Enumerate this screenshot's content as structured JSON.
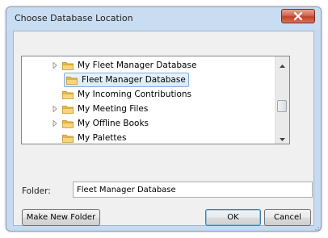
{
  "dialog": {
    "title": "Choose Database Location"
  },
  "tree": {
    "items": [
      {
        "label": "My Fleet Manager Database",
        "expander": true,
        "indent": 1,
        "selected": false
      },
      {
        "label": "Fleet Manager Database",
        "expander": false,
        "indent": 2,
        "selected": true
      },
      {
        "label": "My Incoming Contributions",
        "expander": false,
        "indent": 1,
        "selected": false
      },
      {
        "label": "My Meeting Files",
        "expander": true,
        "indent": 1,
        "selected": false
      },
      {
        "label": "My Offline Books",
        "expander": true,
        "indent": 1,
        "selected": false
      },
      {
        "label": "My Palettes",
        "expander": false,
        "indent": 1,
        "selected": false
      }
    ]
  },
  "folder": {
    "label": "Folder:",
    "value": "Fleet Manager Database"
  },
  "buttons": {
    "make_new_folder": "Make New Folder",
    "ok": "OK",
    "cancel": "Cancel"
  },
  "colors": {
    "title_bar": "#c9ddf2",
    "close_button": "#c0412a",
    "selection": "#d9ebfb",
    "folder_icon": "#e8b84a"
  },
  "icons": {
    "close": "close-icon",
    "expander": "expander-arrow-icon",
    "folder": "folder-icon"
  }
}
